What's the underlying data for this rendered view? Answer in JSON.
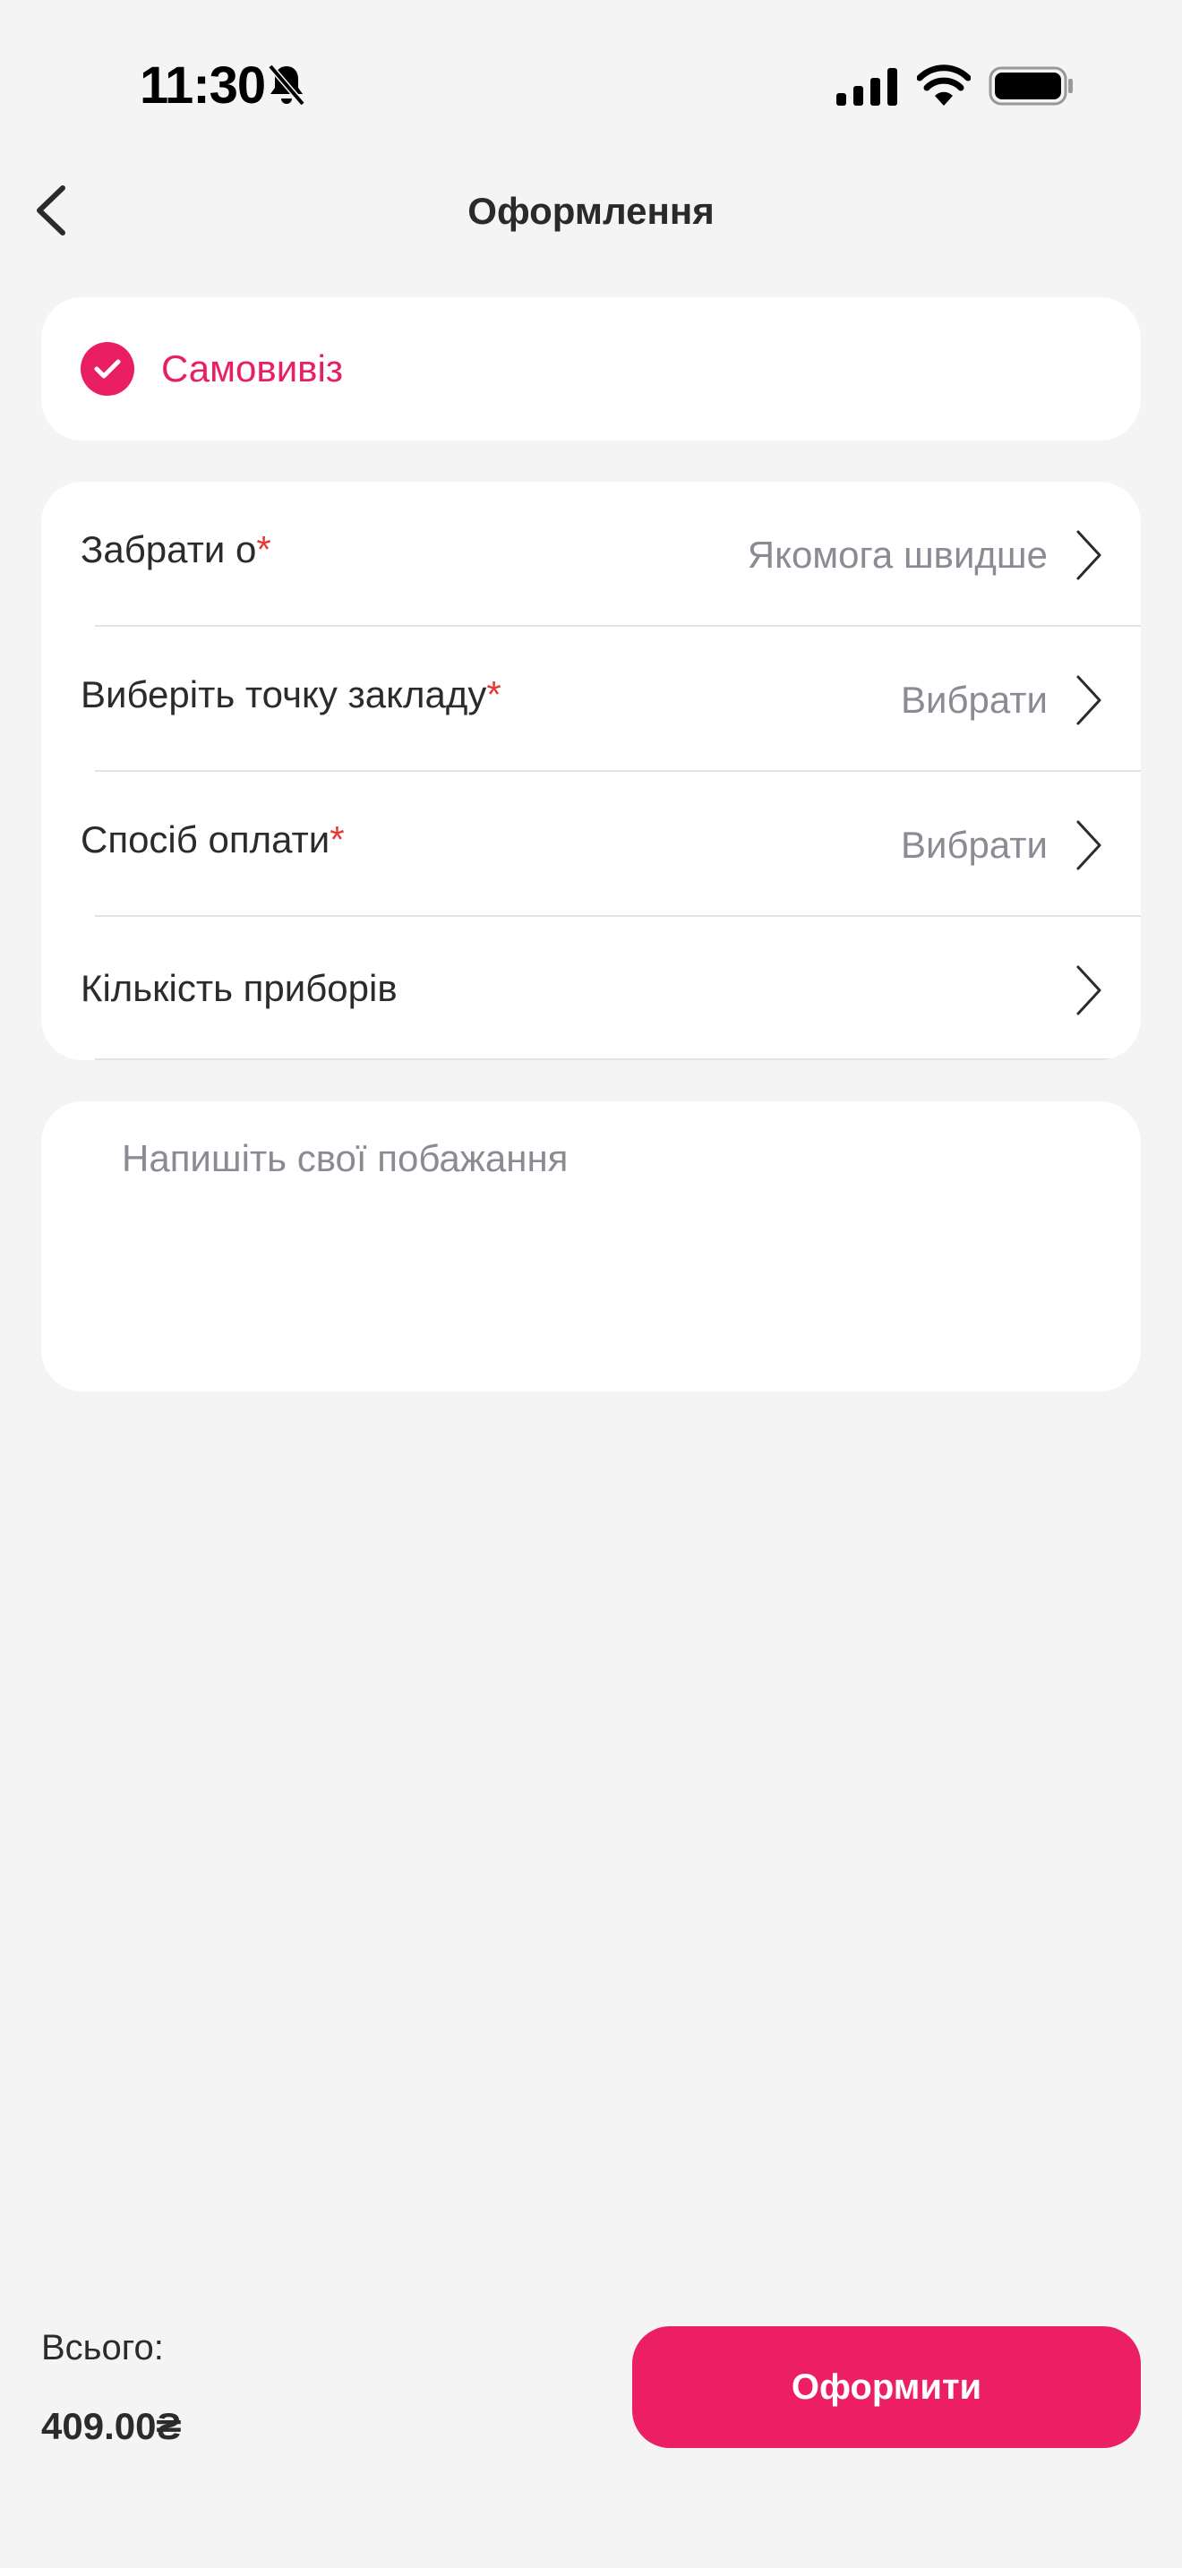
{
  "status_bar": {
    "time": "11:30",
    "icons": [
      "bell-slash-icon",
      "cellular-signal-icon",
      "wifi-icon",
      "battery-icon"
    ]
  },
  "header": {
    "title": "Оформлення",
    "back_icon": "chevron-left-icon"
  },
  "delivery": {
    "label": "Самовивіз",
    "selected": true,
    "icon": "check-circle-icon"
  },
  "options": [
    {
      "label": "Забрати о",
      "required": "*",
      "value": "Якомога швидше"
    },
    {
      "label": "Виберіть точку закладу",
      "required": "*",
      "value": "Вибрати"
    },
    {
      "label": "Спосіб оплати",
      "required": "*",
      "value": "Вибрати"
    },
    {
      "label": "Кількість приборів",
      "required": "",
      "value": ""
    }
  ],
  "wishes": {
    "placeholder": "Напишіть свої побажання",
    "value": ""
  },
  "footer": {
    "total_label": "Всього:",
    "total_value": "409.00₴",
    "submit_label": "Оформити"
  },
  "colors": {
    "accent": "#ec1f64",
    "background": "#f4f4f4",
    "card": "#ffffff",
    "muted_text": "#8b8b93",
    "required": "#e53935"
  }
}
